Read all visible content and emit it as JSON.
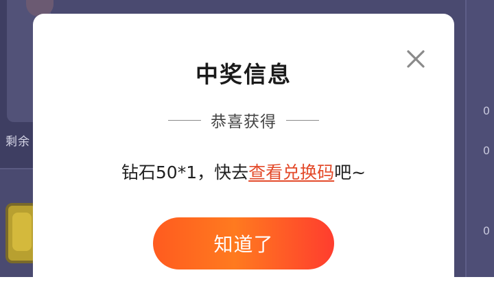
{
  "background": {
    "remaining_label": "剩余",
    "right_numbers": [
      "0",
      "0",
      "0"
    ]
  },
  "modal": {
    "title": "中奖信息",
    "subtitle": "恭喜获得",
    "prize_text": "钻石50*1，快去",
    "link_text": "查看兑换码",
    "prize_suffix": "吧~",
    "confirm_label": "知道了",
    "close_icon": "close-icon"
  },
  "colors": {
    "link": "#e34a2a",
    "button_gradient_start": "#ff5b1f",
    "button_gradient_end": "#ff3d2e",
    "overlay_bg": "#4a4a70"
  }
}
